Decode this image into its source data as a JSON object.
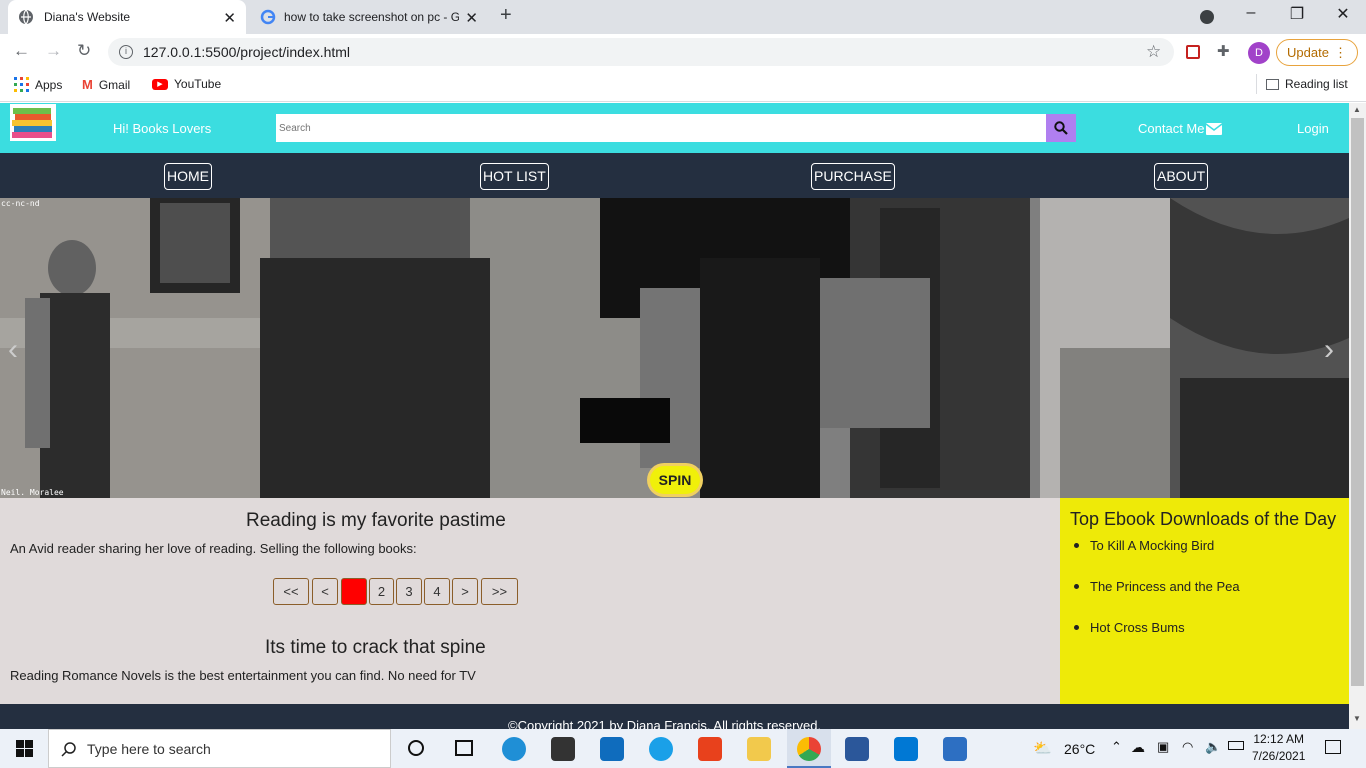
{
  "browser": {
    "tabs": [
      {
        "title": "Diana's Website",
        "active": true
      },
      {
        "title": "how to take screenshot on pc - G",
        "active": false
      }
    ],
    "url": "127.0.0.1:5500/project/index.html",
    "update_label": "Update",
    "profile_initial": "D",
    "bookmarks": [
      {
        "label": "Apps",
        "icon": "apps-grid-icon"
      },
      {
        "label": "Gmail",
        "icon": "gmail-icon"
      },
      {
        "label": "YouTube",
        "icon": "youtube-icon"
      }
    ],
    "reading_list": "Reading list"
  },
  "site": {
    "greeting": "Hi! Books Lovers",
    "search_placeholder": "Search",
    "contact": "Contact Me",
    "login": "Login",
    "nav": [
      "HOME",
      "HOT LIST",
      "PURCHASE",
      "ABOUT"
    ],
    "hero": {
      "credit_top": "cc-nc-nd",
      "credit_bottom": "Neil. Moralee",
      "spin_label": "SPIN",
      "prev": "‹",
      "next": "›"
    },
    "main": {
      "heading1": "Reading is my favorite pastime",
      "text1": "An Avid reader sharing her love of reading. Selling the following books:",
      "pagination": [
        "<<",
        "<",
        "1",
        "2",
        "3",
        "4",
        ">",
        ">>"
      ],
      "active_page": "1",
      "heading2": "Its time to crack that spine",
      "text2": "Reading Romance Novels is the best entertainment you can find. No need for TV"
    },
    "aside": {
      "title": "Top Ebook Downloads of the Day",
      "items": [
        "To Kill A Mocking Bird",
        "The Princess and the Pea",
        "Hot Cross Bums"
      ]
    },
    "footer": "©Copyright 2021 by Diana Francis. All rights reserved."
  },
  "taskbar": {
    "search_placeholder": "Type here to search",
    "weather": "26°C",
    "time": "12:12 AM",
    "date": "7/26/2021"
  },
  "colors": {
    "header": "#3bdde0",
    "nav": "#242f40",
    "main_bg": "#e0dada",
    "aside_bg": "#eeea08",
    "search_btn": "#b07ff0",
    "spin": "#f0f00a"
  }
}
